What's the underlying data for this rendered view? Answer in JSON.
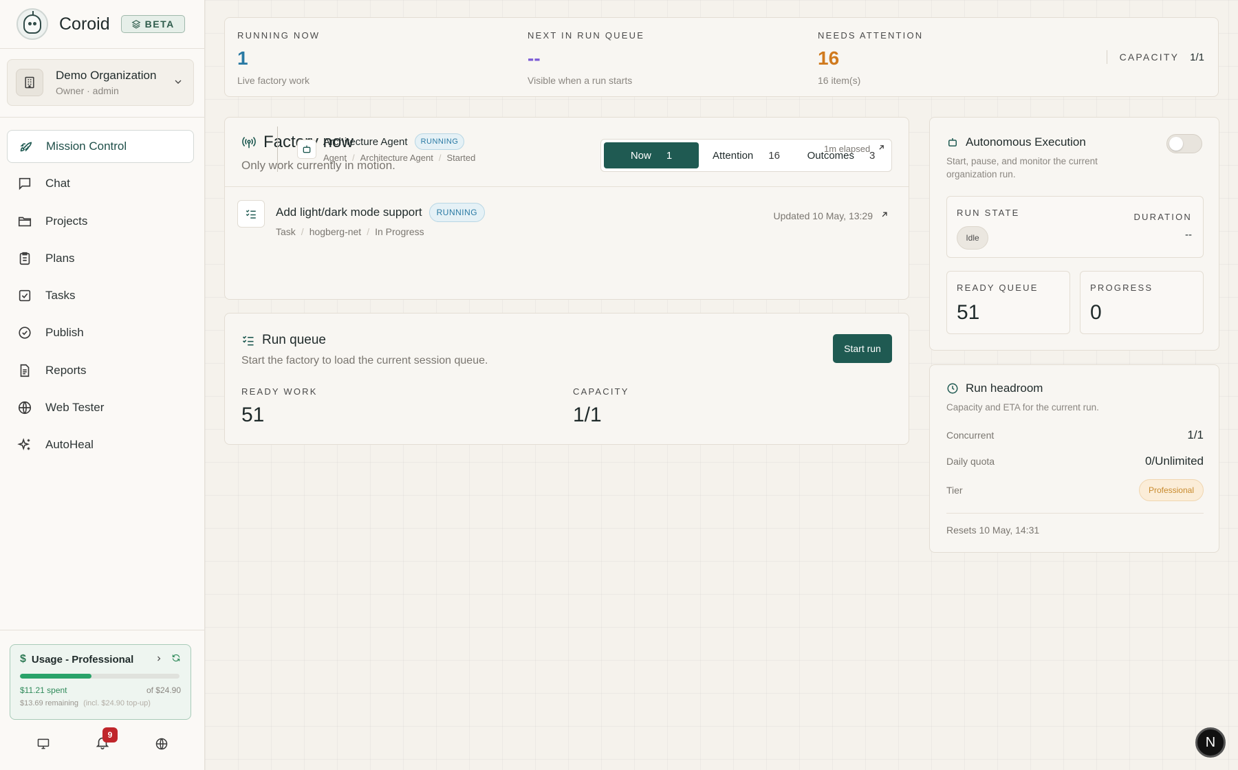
{
  "brand": {
    "name": "Coroid",
    "badge": "BETA"
  },
  "org": {
    "name": "Demo Organization",
    "role": "Owner · admin"
  },
  "nav": [
    {
      "label": "Mission Control",
      "icon": "rocket-icon",
      "active": true
    },
    {
      "label": "Chat",
      "icon": "chat-icon"
    },
    {
      "label": "Projects",
      "icon": "folder-icon"
    },
    {
      "label": "Plans",
      "icon": "clipboard-icon"
    },
    {
      "label": "Tasks",
      "icon": "checkbox-icon"
    },
    {
      "label": "Publish",
      "icon": "badge-check-icon"
    },
    {
      "label": "Reports",
      "icon": "document-icon"
    },
    {
      "label": "Web Tester",
      "icon": "globe-icon"
    },
    {
      "label": "AutoHeal",
      "icon": "sparkles-icon"
    }
  ],
  "usage": {
    "title": "Usage - Professional",
    "spent": "$11.21 spent",
    "of": "of $24.90",
    "remaining": "$13.69 remaining",
    "topup": "(incl. $24.90 top-up)",
    "progress": 0.45
  },
  "notifications": {
    "count": "9"
  },
  "stats": {
    "running": {
      "label": "RUNNING NOW",
      "value": "1",
      "sub": "Live factory work",
      "color": "#2a7aa4"
    },
    "next": {
      "label": "NEXT IN RUN QUEUE",
      "value": "--",
      "sub": "Visible when a run starts",
      "color": "#7b5bd6"
    },
    "attention": {
      "label": "NEEDS ATTENTION",
      "value": "16",
      "sub": "16 item(s)",
      "color": "#d07a1e"
    },
    "capacity": {
      "label": "CAPACITY",
      "value": "1/1"
    }
  },
  "factory": {
    "title": "Factory now",
    "subtitle": "Only work currently in motion.",
    "tabs": [
      {
        "label": "Now",
        "count": "1",
        "active": true
      },
      {
        "label": "Attention",
        "count": "16"
      },
      {
        "label": "Outcomes",
        "count": "3"
      }
    ],
    "task": {
      "title": "Add light/dark mode support",
      "status": "RUNNING",
      "type": "Task",
      "project": "hogberg-net",
      "state": "In Progress",
      "updated": "Updated 10 May, 13:29"
    },
    "agent": {
      "title": "Architecture Agent",
      "status": "RUNNING",
      "type": "Agent",
      "name": "Architecture Agent",
      "state": "Started",
      "elapsed": "1m elapsed"
    }
  },
  "queue": {
    "title": "Run queue",
    "subtitle": "Start the factory to load the current session queue.",
    "button": "Start run",
    "ready_label": "READY WORK",
    "ready_value": "51",
    "capacity_label": "CAPACITY",
    "capacity_value": "1/1"
  },
  "auto": {
    "title": "Autonomous Execution",
    "subtitle": "Start, pause, and monitor the current organization run.",
    "toggle_on": false,
    "run_state_label": "RUN STATE",
    "run_state": "Idle",
    "duration_label": "DURATION",
    "duration": "--",
    "ready_label": "READY QUEUE",
    "ready_value": "51",
    "progress_label": "PROGRESS",
    "progress_value": "0"
  },
  "headroom": {
    "title": "Run headroom",
    "subtitle": "Capacity and ETA for the current run.",
    "concurrent_label": "Concurrent",
    "concurrent": "1/1",
    "quota_label": "Daily quota",
    "quota": "0/Unlimited",
    "tier_label": "Tier",
    "tier": "Professional",
    "resets": "Resets 10 May, 14:31"
  },
  "fab": {
    "label": "N"
  }
}
